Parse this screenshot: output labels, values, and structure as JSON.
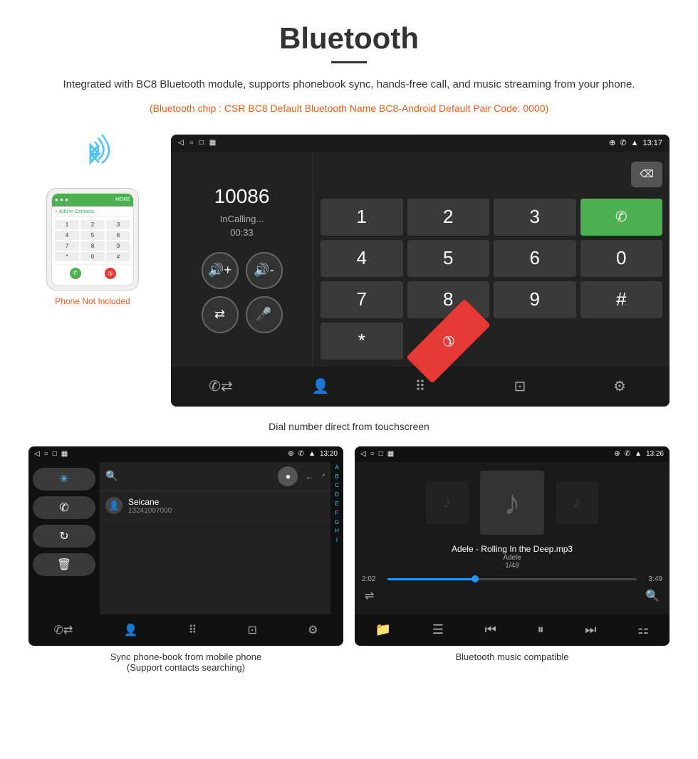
{
  "header": {
    "title": "Bluetooth",
    "underline": true,
    "description": "Integrated with BC8 Bluetooth module, supports phonebook sync, hands-free call, and music streaming from your phone.",
    "specs": "(Bluetooth chip : CSR BC8    Default Bluetooth Name BC8-Android    Default Pair Code: 0000)"
  },
  "phone_label": "Phone Not Included",
  "dialer": {
    "number": "10086",
    "status": "InCalling...",
    "timer": "00:33",
    "time": "13:17",
    "keys": [
      "1",
      "2",
      "3",
      "*",
      "4",
      "5",
      "6",
      "0",
      "7",
      "8",
      "9",
      "#"
    ],
    "call_green": "📞",
    "call_red": "📞"
  },
  "captions": {
    "dialer": "Dial number direct from touchscreen",
    "phonebook": "Sync phone-book from mobile phone\n(Support contacts searching)",
    "music": "Bluetooth music compatible"
  },
  "phonebook": {
    "time": "13:20",
    "contact_name": "Seicane",
    "contact_number": "13241007000",
    "alphabet": [
      "A",
      "B",
      "C",
      "D",
      "E",
      "F",
      "G",
      "H",
      "I"
    ]
  },
  "music": {
    "time": "13:26",
    "song": "Adele - Rolling In the Deep.mp3",
    "artist": "Adele",
    "track_info": "1/48",
    "current_time": "2:02",
    "total_time": "3:49",
    "progress_pct": 35
  }
}
